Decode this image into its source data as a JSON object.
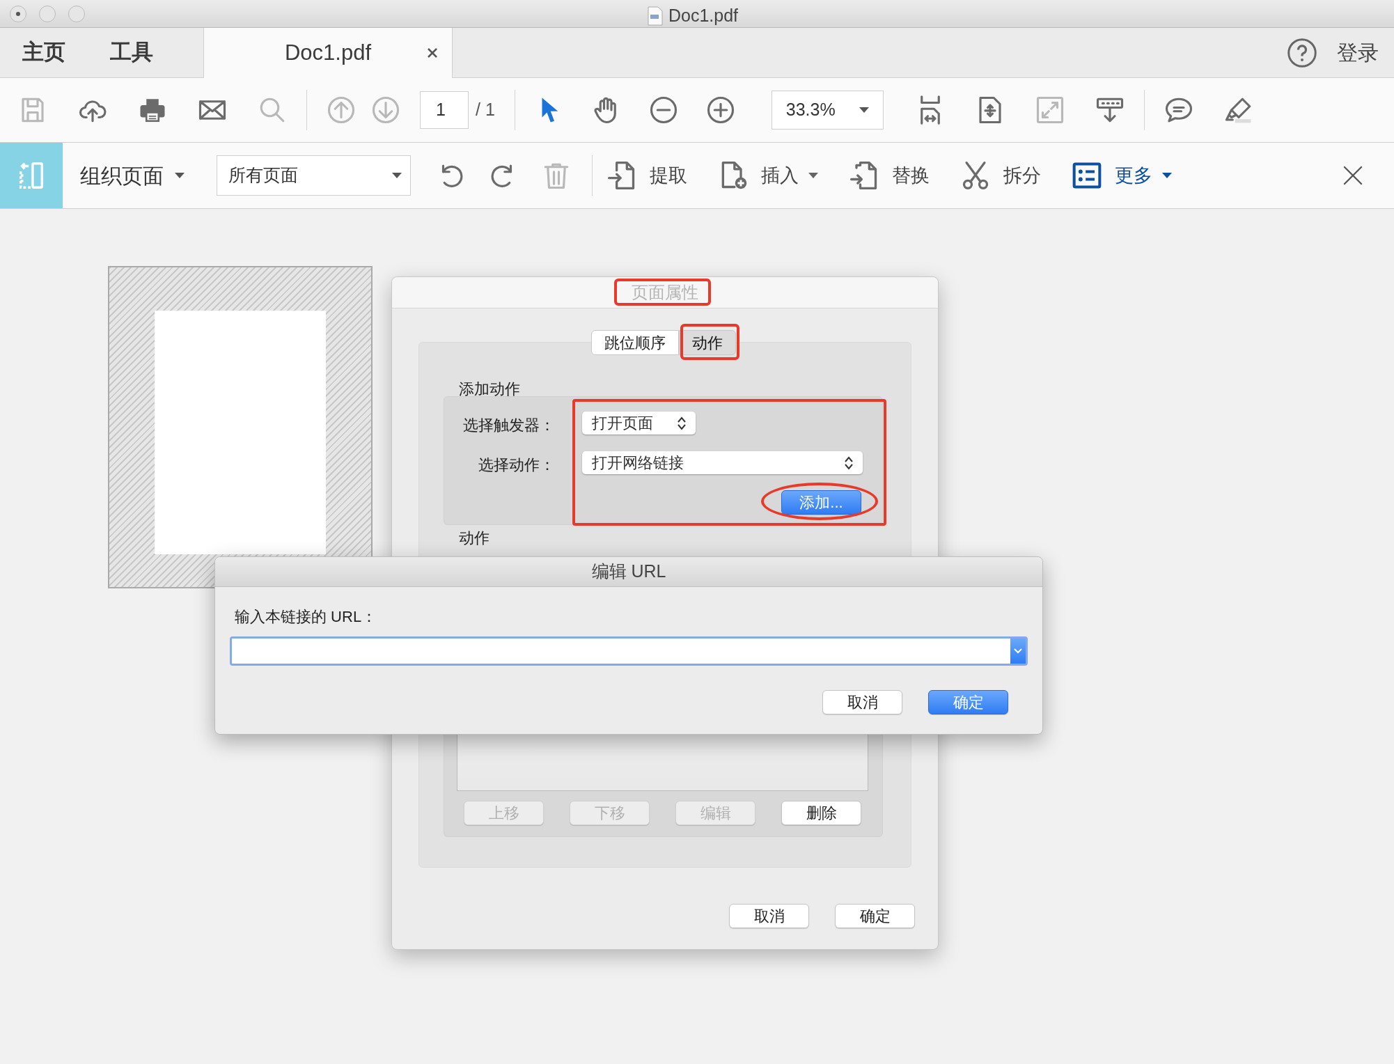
{
  "window": {
    "title": "Doc1.pdf"
  },
  "nav_tabs": [
    {
      "label": "主页",
      "selected": false,
      "closable": false
    },
    {
      "label": "工具",
      "selected": false,
      "closable": false
    },
    {
      "label": "Doc1.pdf",
      "selected": true,
      "closable": true
    }
  ],
  "account": {
    "login": "登录"
  },
  "toolbar": {
    "file_tools": [
      {
        "kind": "save",
        "disabled": true
      },
      {
        "kind": "upload",
        "disabled": false
      },
      {
        "kind": "print",
        "disabled": false
      },
      {
        "kind": "mail",
        "disabled": false
      },
      {
        "kind": "search",
        "disabled": true
      }
    ],
    "page_nav": [
      {
        "kind": "prev",
        "disabled": true
      },
      {
        "kind": "next",
        "disabled": true
      }
    ],
    "page_number": "1",
    "page_total": "/ 1",
    "view_tools": [
      {
        "kind": "pointer",
        "disabled": false
      },
      {
        "kind": "hand",
        "disabled": false
      },
      {
        "kind": "zoom-out",
        "disabled": false
      },
      {
        "kind": "zoom-in",
        "disabled": false
      }
    ],
    "zoom": "33.3%",
    "layout_tools": [
      {
        "kind": "fit-width",
        "disabled": false
      },
      {
        "kind": "fit-page",
        "disabled": false
      },
      {
        "kind": "fullscreen",
        "disabled": true
      },
      {
        "kind": "scroll",
        "disabled": false
      }
    ],
    "comment_tools": [
      {
        "kind": "comment",
        "disabled": false
      },
      {
        "kind": "highlight",
        "disabled": false
      }
    ]
  },
  "organize_toolbar": {
    "title": "组织页面",
    "page_range": "所有页面",
    "edit_tools": [
      {
        "kind": "rotate-left",
        "disabled": false
      },
      {
        "kind": "rotate-right",
        "disabled": false
      },
      {
        "kind": "delete",
        "disabled": true
      }
    ],
    "actions": [
      {
        "label": "提取",
        "kind": "extract",
        "dropdown": false,
        "highlighted": false
      },
      {
        "label": "插入",
        "kind": "insert",
        "dropdown": true,
        "highlighted": false
      },
      {
        "label": "替换",
        "kind": "replace",
        "dropdown": false,
        "highlighted": false
      },
      {
        "label": "拆分",
        "kind": "split",
        "dropdown": false,
        "highlighted": false
      },
      {
        "label": "更多",
        "kind": "more",
        "dropdown": true,
        "highlighted": true
      }
    ]
  },
  "page_properties_dialog": {
    "title": "页面属性",
    "tabs": [
      {
        "label": "跳位顺序",
        "selected": false
      },
      {
        "label": "动作",
        "selected": true
      }
    ],
    "add_action_heading": "添加动作",
    "trigger_label": "选择触发器：",
    "trigger_value": "打开页面",
    "action_label": "选择动作：",
    "action_value": "打开网络链接",
    "add_button": "添加...",
    "actions_heading": "动作",
    "list_buttons": [
      {
        "label": "上移",
        "disabled": true
      },
      {
        "label": "下移",
        "disabled": true
      },
      {
        "label": "编辑",
        "disabled": true
      },
      {
        "label": "删除",
        "disabled": false
      }
    ],
    "buttons": [
      {
        "label": "取消",
        "default": false
      },
      {
        "label": "确定",
        "default": false
      }
    ]
  },
  "edit_url_dialog": {
    "title": "编辑 URL",
    "prompt": "输入本链接的 URL：",
    "buttons": [
      {
        "label": "取消",
        "default": false
      },
      {
        "label": "确定",
        "default": true
      }
    ]
  }
}
